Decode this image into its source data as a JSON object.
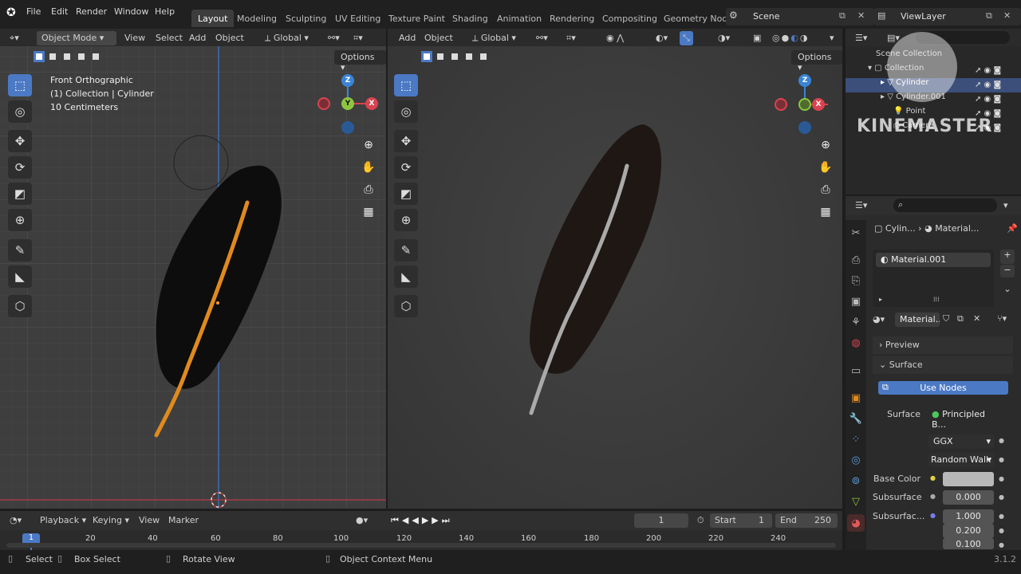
{
  "topbar": {
    "menus": [
      "File",
      "Edit",
      "Render",
      "Window",
      "Help"
    ],
    "workspaces": [
      "Layout",
      "Modeling",
      "Sculpting",
      "UV Editing",
      "Texture Paint",
      "Shading",
      "Animation",
      "Rendering",
      "Compositing",
      "Geometry Nod"
    ],
    "active_workspace": "Layout",
    "scene": "Scene",
    "view_layer": "ViewLayer"
  },
  "left_viewport": {
    "mode": "Object Mode",
    "menus": [
      "View",
      "Select",
      "Add",
      "Object"
    ],
    "orientation": "Global",
    "options": "Options",
    "info": [
      "Front Orthographic",
      "(1) Collection | Cylinder",
      "10 Centimeters"
    ]
  },
  "right_viewport": {
    "menus": [
      "Add",
      "Object"
    ],
    "orientation": "Global",
    "options": "Options"
  },
  "gizmo": {
    "z": "Z",
    "y": "Y",
    "x": "X"
  },
  "outliner": {
    "rows": [
      "Scene Collection",
      "Collection",
      "Cylinder",
      "Cylinder.001",
      "Point",
      "Camera"
    ],
    "watermark": "KINEMASTER"
  },
  "properties": {
    "breadcrumb": [
      "Cylin...",
      "Material..."
    ],
    "slot": "Material.001",
    "material_name": "Material...",
    "preview": "Preview",
    "surface_panel": "Surface",
    "use_nodes": "Use Nodes",
    "surface_label": "Surface",
    "surface_value": "Principled B...",
    "distribution": "GGX",
    "subsurface_method": "Random Walk",
    "base_color_label": "Base Color",
    "subsurface_label": "Subsurface",
    "subsurface_value": "0.000",
    "subsurf_radius_label": "Subsurfac...",
    "radius": [
      "1.000",
      "0.200",
      "0.100"
    ]
  },
  "timeline": {
    "menus": [
      "Playback",
      "Keying",
      "View",
      "Marker"
    ],
    "current_frame": "1",
    "start_label": "Start",
    "start": "1",
    "end_label": "End",
    "end": "250",
    "playhead": "1",
    "ticks": [
      "20",
      "40",
      "60",
      "80",
      "100",
      "120",
      "140",
      "160",
      "180",
      "200",
      "220",
      "240"
    ]
  },
  "statusbar": {
    "items": [
      "Select",
      "Box Select",
      "Rotate View",
      "Object Context Menu"
    ],
    "version": "3.1.2"
  },
  "colors": {
    "accent": "#4b79c4",
    "orange": "#e08a1e",
    "x_axis": "#d9434f",
    "y_axis": "#8cc63f",
    "z_axis": "#3a84d6"
  }
}
